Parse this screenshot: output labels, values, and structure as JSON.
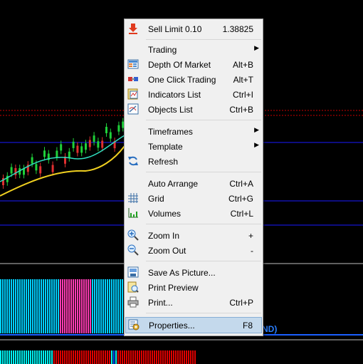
{
  "chart_data": {
    "type": "candlestick",
    "background": "#000000",
    "overlay_text": "ND)",
    "overlay_text_color": "#2a7fff",
    "indicator_colors": [
      "#00d0ff",
      "#ff3cb4",
      "#ff0000",
      "#0000ff"
    ]
  },
  "menu": {
    "items": [
      {
        "label": "Sell Limit 0.10",
        "shortcut": "1.38825",
        "icon": "sell-limit-icon"
      },
      {
        "label": "Trading",
        "shortcut": "",
        "submenu": true
      },
      {
        "label": "Depth Of Market",
        "shortcut": "Alt+B",
        "icon": "depth-of-market-icon"
      },
      {
        "label": "One Click Trading",
        "shortcut": "Alt+T",
        "icon": "one-click-trading-icon"
      },
      {
        "label": "Indicators List",
        "shortcut": "Ctrl+I",
        "icon": "indicators-list-icon"
      },
      {
        "label": "Objects List",
        "shortcut": "Ctrl+B",
        "icon": "objects-list-icon"
      },
      {
        "label": "Timeframes",
        "shortcut": "",
        "submenu": true
      },
      {
        "label": "Template",
        "shortcut": "",
        "submenu": true
      },
      {
        "label": "Refresh",
        "shortcut": "",
        "icon": "refresh-icon"
      },
      {
        "label": "Auto Arrange",
        "shortcut": "Ctrl+A"
      },
      {
        "label": "Grid",
        "shortcut": "Ctrl+G",
        "icon": "grid-icon"
      },
      {
        "label": "Volumes",
        "shortcut": "Ctrl+L",
        "icon": "volumes-icon"
      },
      {
        "label": "Zoom In",
        "shortcut": "+",
        "icon": "zoom-in-icon"
      },
      {
        "label": "Zoom Out",
        "shortcut": "-",
        "icon": "zoom-out-icon"
      },
      {
        "label": "Save As Picture...",
        "shortcut": "",
        "icon": "save-picture-icon"
      },
      {
        "label": "Print Preview",
        "shortcut": "",
        "icon": "print-preview-icon"
      },
      {
        "label": "Print...",
        "shortcut": "Ctrl+P",
        "icon": "print-icon"
      },
      {
        "label": "Properties...",
        "shortcut": "F8",
        "icon": "properties-icon",
        "highlighted": true
      }
    ]
  }
}
